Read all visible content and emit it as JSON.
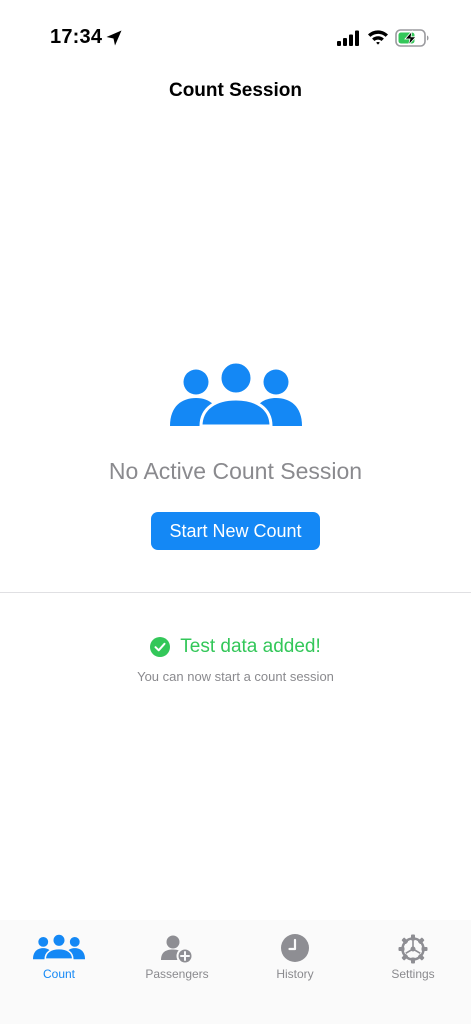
{
  "status_bar": {
    "time": "17:34",
    "icons": [
      "location-arrow-icon",
      "cellular-signal-icon",
      "wifi-icon",
      "battery-charging-icon"
    ]
  },
  "nav": {
    "title": "Count Session"
  },
  "empty_state": {
    "icon": "people-group-icon",
    "title": "No Active Count Session",
    "button_label": "Start New Count"
  },
  "notice": {
    "icon": "checkmark-circle-icon",
    "title": "Test data added!",
    "subtitle": "You can now start a count session"
  },
  "tabs": [
    {
      "label": "Count",
      "icon": "people-group-icon",
      "active": true
    },
    {
      "label": "Passengers",
      "icon": "person-add-icon",
      "active": false
    },
    {
      "label": "History",
      "icon": "clock-icon",
      "active": false
    },
    {
      "label": "Settings",
      "icon": "gear-icon",
      "active": false
    }
  ],
  "colors": {
    "accent": "#1488f5",
    "success": "#33c759",
    "secondary_text": "#8a8a8e",
    "inactive_tab": "#8e8e93"
  }
}
